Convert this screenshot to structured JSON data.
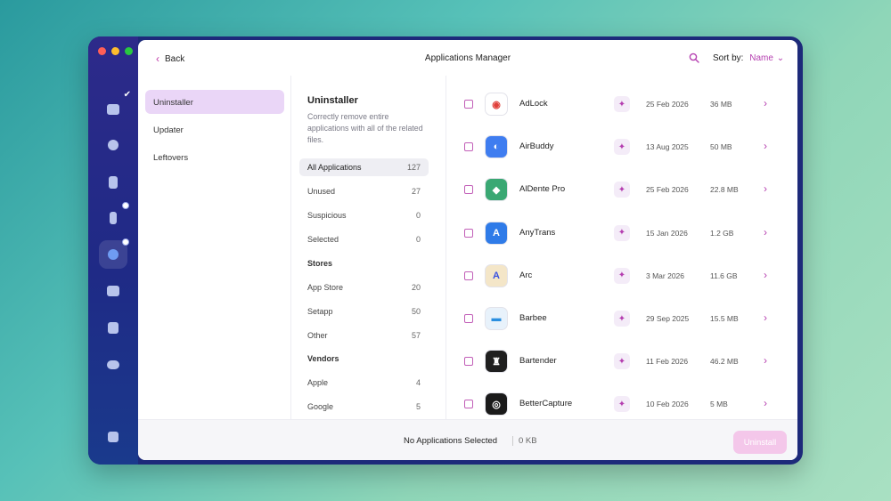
{
  "window": {
    "title": "Applications Manager",
    "back_label": "Back",
    "sort_label": "Sort by:",
    "sort_value": "Name",
    "sort_chevron": "⌄",
    "back_chevron": "‹",
    "row_chevron": "›",
    "sparkle_glyph": "✦"
  },
  "sidebar_icons": [
    "monitor-icon",
    "disk-icon",
    "hand-icon",
    "bolt-icon",
    "app-store-icon",
    "folder-icon",
    "drive-icon",
    "cloud-icon",
    "chart-icon"
  ],
  "categories": [
    {
      "label": "Uninstaller",
      "active": true
    },
    {
      "label": "Updater",
      "active": false
    },
    {
      "label": "Leftovers",
      "active": false
    }
  ],
  "filter_panel": {
    "title": "Uninstaller",
    "description": "Correctly remove entire applications with all of the related files.",
    "rows": [
      {
        "label": "All Applications",
        "count": "127",
        "active": true
      },
      {
        "label": "Unused",
        "count": "27"
      },
      {
        "label": "Suspicious",
        "count": "0"
      },
      {
        "label": "Selected",
        "count": "0"
      }
    ],
    "stores_heading": "Stores",
    "stores": [
      {
        "label": "App Store",
        "count": "20"
      },
      {
        "label": "Setapp",
        "count": "50"
      },
      {
        "label": "Other",
        "count": "57"
      }
    ],
    "vendors_heading": "Vendors",
    "vendors": [
      {
        "label": "Apple",
        "count": "4"
      },
      {
        "label": "Google",
        "count": "5"
      }
    ]
  },
  "apps": [
    {
      "name": "AdLock",
      "date": "25 Feb 2026",
      "size": "36 MB",
      "icon": "adlock-icon",
      "color": "#ffffff",
      "fg": "#e0403a",
      "glyph": "◉"
    },
    {
      "name": "AirBuddy",
      "date": "13 Aug 2025",
      "size": "50 MB",
      "icon": "airbuddy-icon",
      "color": "#3f7df0",
      "fg": "#ffffff",
      "glyph": "◐"
    },
    {
      "name": "AlDente Pro",
      "date": "25 Feb 2026",
      "size": "22.8 MB",
      "icon": "aldente-icon",
      "color": "#3aa873",
      "fg": "#ffffff",
      "glyph": "◆"
    },
    {
      "name": "AnyTrans",
      "date": "15 Jan 2026",
      "size": "1.2 GB",
      "icon": "anytrans-icon",
      "color": "#2f7be8",
      "fg": "#ffffff",
      "glyph": "A"
    },
    {
      "name": "Arc",
      "date": "3 Mar 2026",
      "size": "11.6 GB",
      "icon": "arc-icon",
      "color": "#f4e6c8",
      "fg": "#3a52e0",
      "glyph": "A"
    },
    {
      "name": "Barbee",
      "date": "29 Sep 2025",
      "size": "15.5 MB",
      "icon": "barbee-icon",
      "color": "#e8f2fb",
      "fg": "#2a8fe0",
      "glyph": "▬"
    },
    {
      "name": "Bartender",
      "date": "11 Feb 2026",
      "size": "46.2 MB",
      "icon": "bartender-icon",
      "color": "#1f1f1f",
      "fg": "#ffffff",
      "glyph": "♜"
    },
    {
      "name": "BetterCapture",
      "date": "10 Feb 2026",
      "size": "5 MB",
      "icon": "bettercapture-icon",
      "color": "#1a1a1a",
      "fg": "#ffffff",
      "glyph": "◎"
    }
  ],
  "footer": {
    "selection_text": "No Applications Selected",
    "selection_size": "0 KB",
    "uninstall_label": "Uninstall"
  },
  "colors": {
    "accent": "#b53fb0",
    "sidebar": "#1f2a86",
    "active_category": "#ead6f7"
  }
}
